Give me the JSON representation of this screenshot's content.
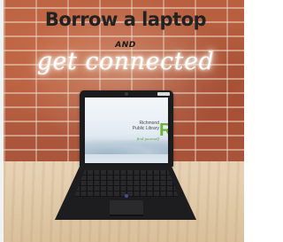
{
  "headline": "Borrow a laptop",
  "and_text": "AND",
  "neon_text": "get connected",
  "screen": {
    "library_name_line1": "Richmond",
    "library_name_line2": "Public Library",
    "tagline": "find yourself",
    "logo_letter": "R"
  },
  "colors": {
    "brick": "#b55a3c",
    "table": "#e0c9a6",
    "headline_text": "#222222",
    "neon": "#ffffff",
    "logo_green": "#6cb33f",
    "laptop": "#1c1c1e"
  }
}
